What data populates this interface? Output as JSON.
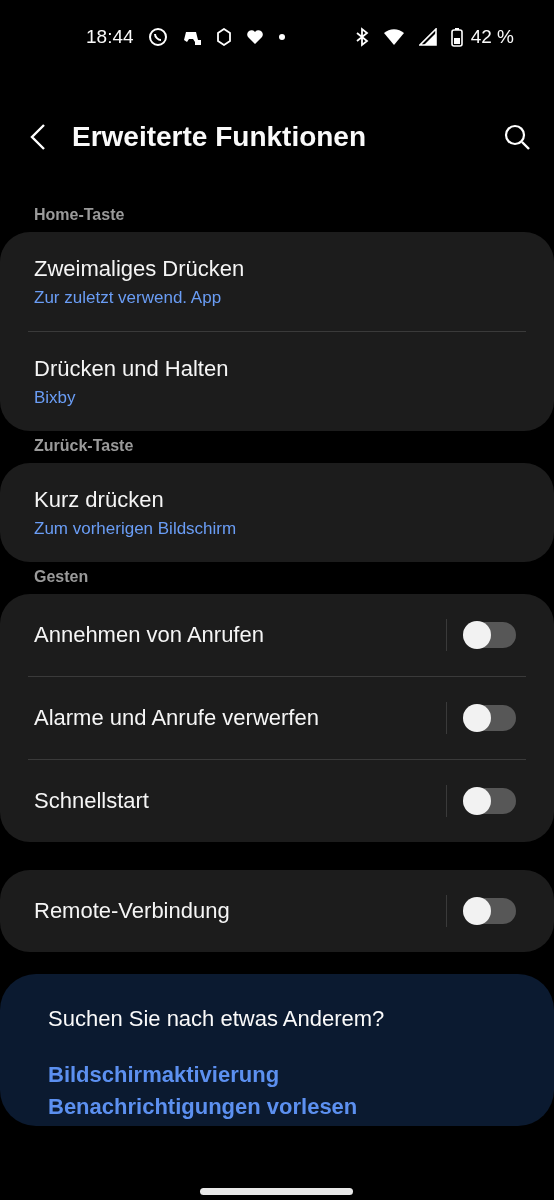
{
  "status_bar": {
    "time": "18:44",
    "battery": "42 %"
  },
  "header": {
    "title": "Erweiterte Funktionen"
  },
  "sections": [
    {
      "label": "Home-Taste",
      "items": [
        {
          "kind": "link",
          "title": "Zweimaliges Drücken",
          "subtitle": "Zur zuletzt verwend. App"
        },
        {
          "kind": "link",
          "title": "Drücken und Halten",
          "subtitle": "Bixby"
        }
      ]
    },
    {
      "label": "Zurück-Taste",
      "items": [
        {
          "kind": "link",
          "title": "Kurz drücken",
          "subtitle": "Zum vorherigen Bildschirm"
        }
      ]
    },
    {
      "label": "Gesten",
      "items": [
        {
          "kind": "toggle",
          "title": "Annehmen von Anrufen",
          "on": false
        },
        {
          "kind": "toggle",
          "title": "Alarme und Anrufe verwerfen",
          "on": false
        },
        {
          "kind": "toggle",
          "title": "Schnellstart",
          "on": false
        }
      ]
    },
    {
      "items": [
        {
          "kind": "toggle",
          "title": "Remote-Verbindung",
          "on": false
        }
      ]
    }
  ],
  "suggestions": {
    "title": "Suchen Sie nach etwas Anderem?",
    "links": [
      "Bildschirmaktivierung",
      "Benachrichtigungen vorlesen"
    ]
  }
}
